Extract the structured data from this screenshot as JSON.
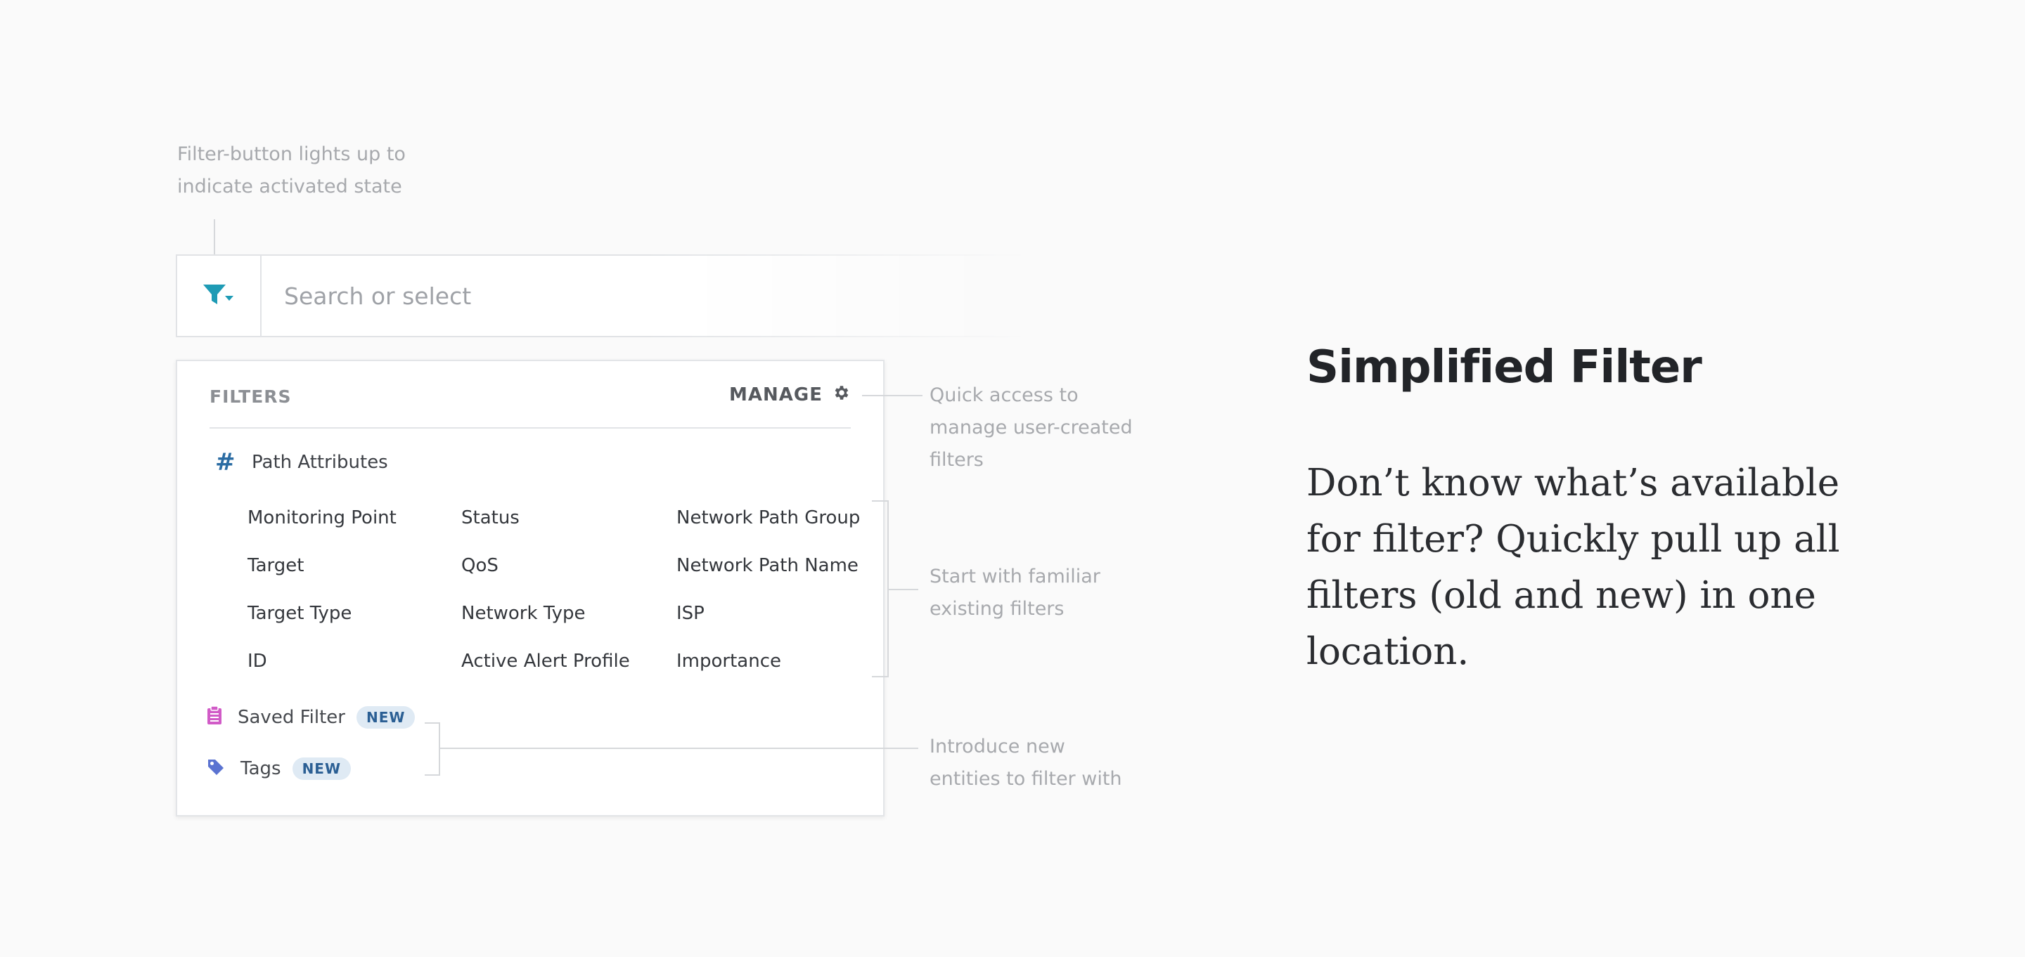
{
  "annotations": {
    "filter_button_note": "Filter-button lights up to\nindicate activated state",
    "manage_note": "Quick access to\nmanage user-created\nfilters",
    "existing_note": "Start with familiar\nexisting filters",
    "new_note": "Introduce new\nentities to filter with"
  },
  "search": {
    "placeholder": "Search or select",
    "filter_icon": "filter-funnel-dropdown-icon",
    "accent_color": "#1e9bb5"
  },
  "panel": {
    "title": "FILTERS",
    "manage_label": "MANAGE",
    "manage_icon": "gear-icon",
    "section_icon": "hash-icon",
    "section_label": "Path Attributes",
    "columns": [
      [
        "Monitoring Point",
        "Target",
        "Target Type",
        "ID"
      ],
      [
        "Status",
        "QoS",
        "Network Type",
        "Active Alert Profile"
      ],
      [
        "Network Path Group",
        "Network Path Name",
        "ISP",
        "Importance"
      ]
    ],
    "entities": [
      {
        "label": "Saved Filter",
        "badge": "NEW",
        "icon": "clipboard-icon",
        "icon_color": "#d15bc7"
      },
      {
        "label": "Tags",
        "badge": "NEW",
        "icon": "tag-icon",
        "icon_color": "#5b73d1"
      }
    ]
  },
  "feature": {
    "title": "Simplified Filter",
    "description": "Don’t know what’s available for filter? Quickly pull up all filters (old and new) in one location."
  }
}
